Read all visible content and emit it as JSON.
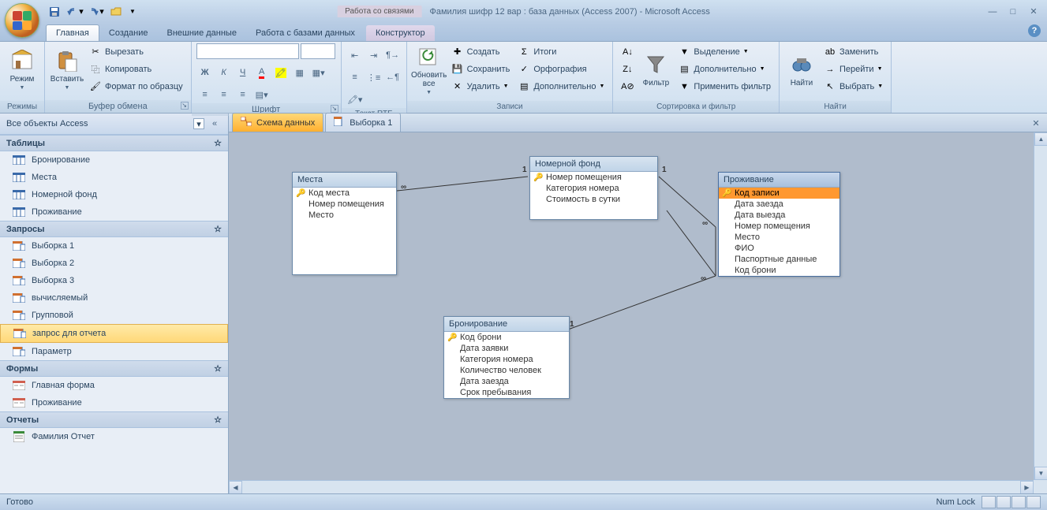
{
  "title": "Фамилия шифр 12 вар : база данных (Access 2007) - Microsoft Access",
  "context_tab_title": "Работа со связями",
  "tabs": [
    "Главная",
    "Создание",
    "Внешние данные",
    "Работа с базами данных",
    "Конструктор"
  ],
  "ribbon": {
    "g0": {
      "label": "Режимы",
      "big": "Режим"
    },
    "g1": {
      "label": "Буфер обмена",
      "big": "Вставить",
      "s0": "Вырезать",
      "s1": "Копировать",
      "s2": "Формат по образцу"
    },
    "g2": {
      "label": "Шрифт"
    },
    "g3": {
      "label": "Текст RTF"
    },
    "g4": {
      "label": "Записи",
      "big": "Обновить все",
      "s0": "Создать",
      "s1": "Сохранить",
      "s2": "Удалить",
      "s3": "Итоги",
      "s4": "Орфография",
      "s5": "Дополнительно"
    },
    "g5": {
      "label": "Сортировка и фильтр",
      "big": "Фильтр",
      "s0": "Выделение",
      "s1": "Дополнительно",
      "s2": "Применить фильтр"
    },
    "g6": {
      "label": "Найти",
      "big": "Найти",
      "s0": "Заменить",
      "s1": "Перейти",
      "s2": "Выбрать"
    }
  },
  "nav": {
    "title": "Все объекты Access",
    "groups": [
      {
        "name": "Таблицы",
        "items": [
          "Бронирование",
          "Места",
          "Номерной фонд",
          "Проживание"
        ]
      },
      {
        "name": "Запросы",
        "items": [
          "Выборка 1",
          "Выборка 2",
          "Выборка 3",
          "вычисляемый",
          "Групповой",
          "запрос для отчета",
          "Параметр"
        ]
      },
      {
        "name": "Формы",
        "items": [
          "Главная форма",
          "Проживание"
        ]
      },
      {
        "name": "Отчеты",
        "items": [
          "Фамилия Отчет"
        ]
      }
    ]
  },
  "doc_tabs": [
    {
      "label": "Схема данных",
      "active": true
    },
    {
      "label": "Выборка 1",
      "active": false
    }
  ],
  "entities": {
    "e0": {
      "title": "Места",
      "fields": [
        "Код места",
        "Номер помещения",
        "Место"
      ],
      "keys": [
        0
      ]
    },
    "e1": {
      "title": "Номерной фонд",
      "fields": [
        "Номер помещения",
        "Категория номера",
        "Стоимость в сутки"
      ],
      "keys": [
        0
      ]
    },
    "e2": {
      "title": "Проживание",
      "fields": [
        "Код записи",
        "Дата заезда",
        "Дата выезда",
        "Номер помещения",
        "Место",
        "ФИО",
        "Паспортные данные",
        "Код брони"
      ],
      "keys": [
        0
      ],
      "selected_field": 0
    },
    "e3": {
      "title": "Бронирование",
      "fields": [
        "Код брони",
        "Дата заявки",
        "Категория номера",
        "Количество человек",
        "Дата заезда",
        "Срок пребывания"
      ],
      "keys": [
        0
      ]
    }
  },
  "status": {
    "left": "Готово",
    "right": "Num Lock"
  }
}
